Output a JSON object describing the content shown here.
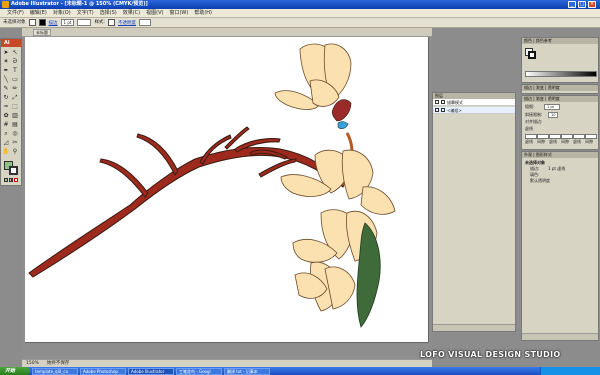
{
  "window": {
    "title": "Adobe Illustrator - [未标题-1 @ 150% (CMYK/预览)]",
    "controls": [
      "_",
      "□",
      "×"
    ]
  },
  "menubar": {
    "items": [
      "文件(F)",
      "编辑(E)",
      "对象(O)",
      "文字(T)",
      "选择(S)",
      "效果(C)",
      "视图(V)",
      "窗口(W)",
      "帮助(H)"
    ]
  },
  "control_bar": {
    "selection_label": "未选择对象",
    "stroke_label": "描边",
    "stroke_weight": "1 pt",
    "style_label": "样式:",
    "opacity_link": "不透明度"
  },
  "toolbox": {
    "header": "Ai",
    "tools": [
      "selection-icon",
      "direct-select-icon",
      "magic-wand-icon",
      "lasso-icon",
      "pen-icon",
      "type-icon",
      "line-icon",
      "rectangle-icon",
      "paintbrush-icon",
      "pencil-icon",
      "rotate-icon",
      "scale-icon",
      "warp-icon",
      "free-transform-icon",
      "symbol-icon",
      "graph-icon",
      "mesh-icon",
      "gradient-icon",
      "eyedropper-icon",
      "blend-icon",
      "slice-icon",
      "scissors-icon",
      "hand-icon",
      "zoom-icon"
    ]
  },
  "document": {
    "tab_label": "未标题"
  },
  "status": {
    "zoom": "150%",
    "state": "始终不保存"
  },
  "panels": {
    "color": {
      "tabs": [
        "颜色",
        "颜色参考"
      ]
    },
    "stroke": {
      "tabs": [
        "描边",
        "渐变",
        "透明度"
      ]
    },
    "gradient": {
      "tabs": [
        "描边",
        "渐变"
      ]
    },
    "layers": {
      "tabs": [
        "图层"
      ],
      "rows": [
        "描摹模式",
        "<编组>"
      ]
    },
    "transparency": {
      "tabs": [
        "描边",
        "渐变",
        "透明度"
      ],
      "weight_label": "粗细:",
      "weight_value": "1 pt",
      "miter_label": "斜接限制:",
      "miter_value": "10",
      "align_label": "对齐描边:",
      "dashed_label": "虚线",
      "dash_cells": [
        "虚线",
        "间隙",
        "虚线",
        "间隙",
        "虚线",
        "间隙"
      ]
    },
    "appearance": {
      "tabs": [
        "外观",
        "图形样式"
      ],
      "header": "未选择对象",
      "stroke_label": "描边:",
      "stroke_value": "1 pt 虚线",
      "fill_label": "填色:",
      "opacity_label": "默认透明度"
    }
  },
  "taskbar": {
    "start": "开始",
    "tasks": [
      "template_ql0_ca",
      "Adobe Photoshop",
      "Adobe Illustrator",
      "工笔花鸟 - Googl",
      "翻译 txt - 记事本"
    ]
  },
  "watermark": "LOFO VISUAL DESIGN STUDIO",
  "colors": {
    "titlebar": "#0b3fb0",
    "illustrator_brand": "#c8482a",
    "branch": "#9e2a1e",
    "branch_end": "#b55a25",
    "petal_fill": "#fbe1b0",
    "petal_stroke": "#6b4a2a",
    "leaf": "#3f6b3a",
    "bud": "#9a2b2b"
  }
}
